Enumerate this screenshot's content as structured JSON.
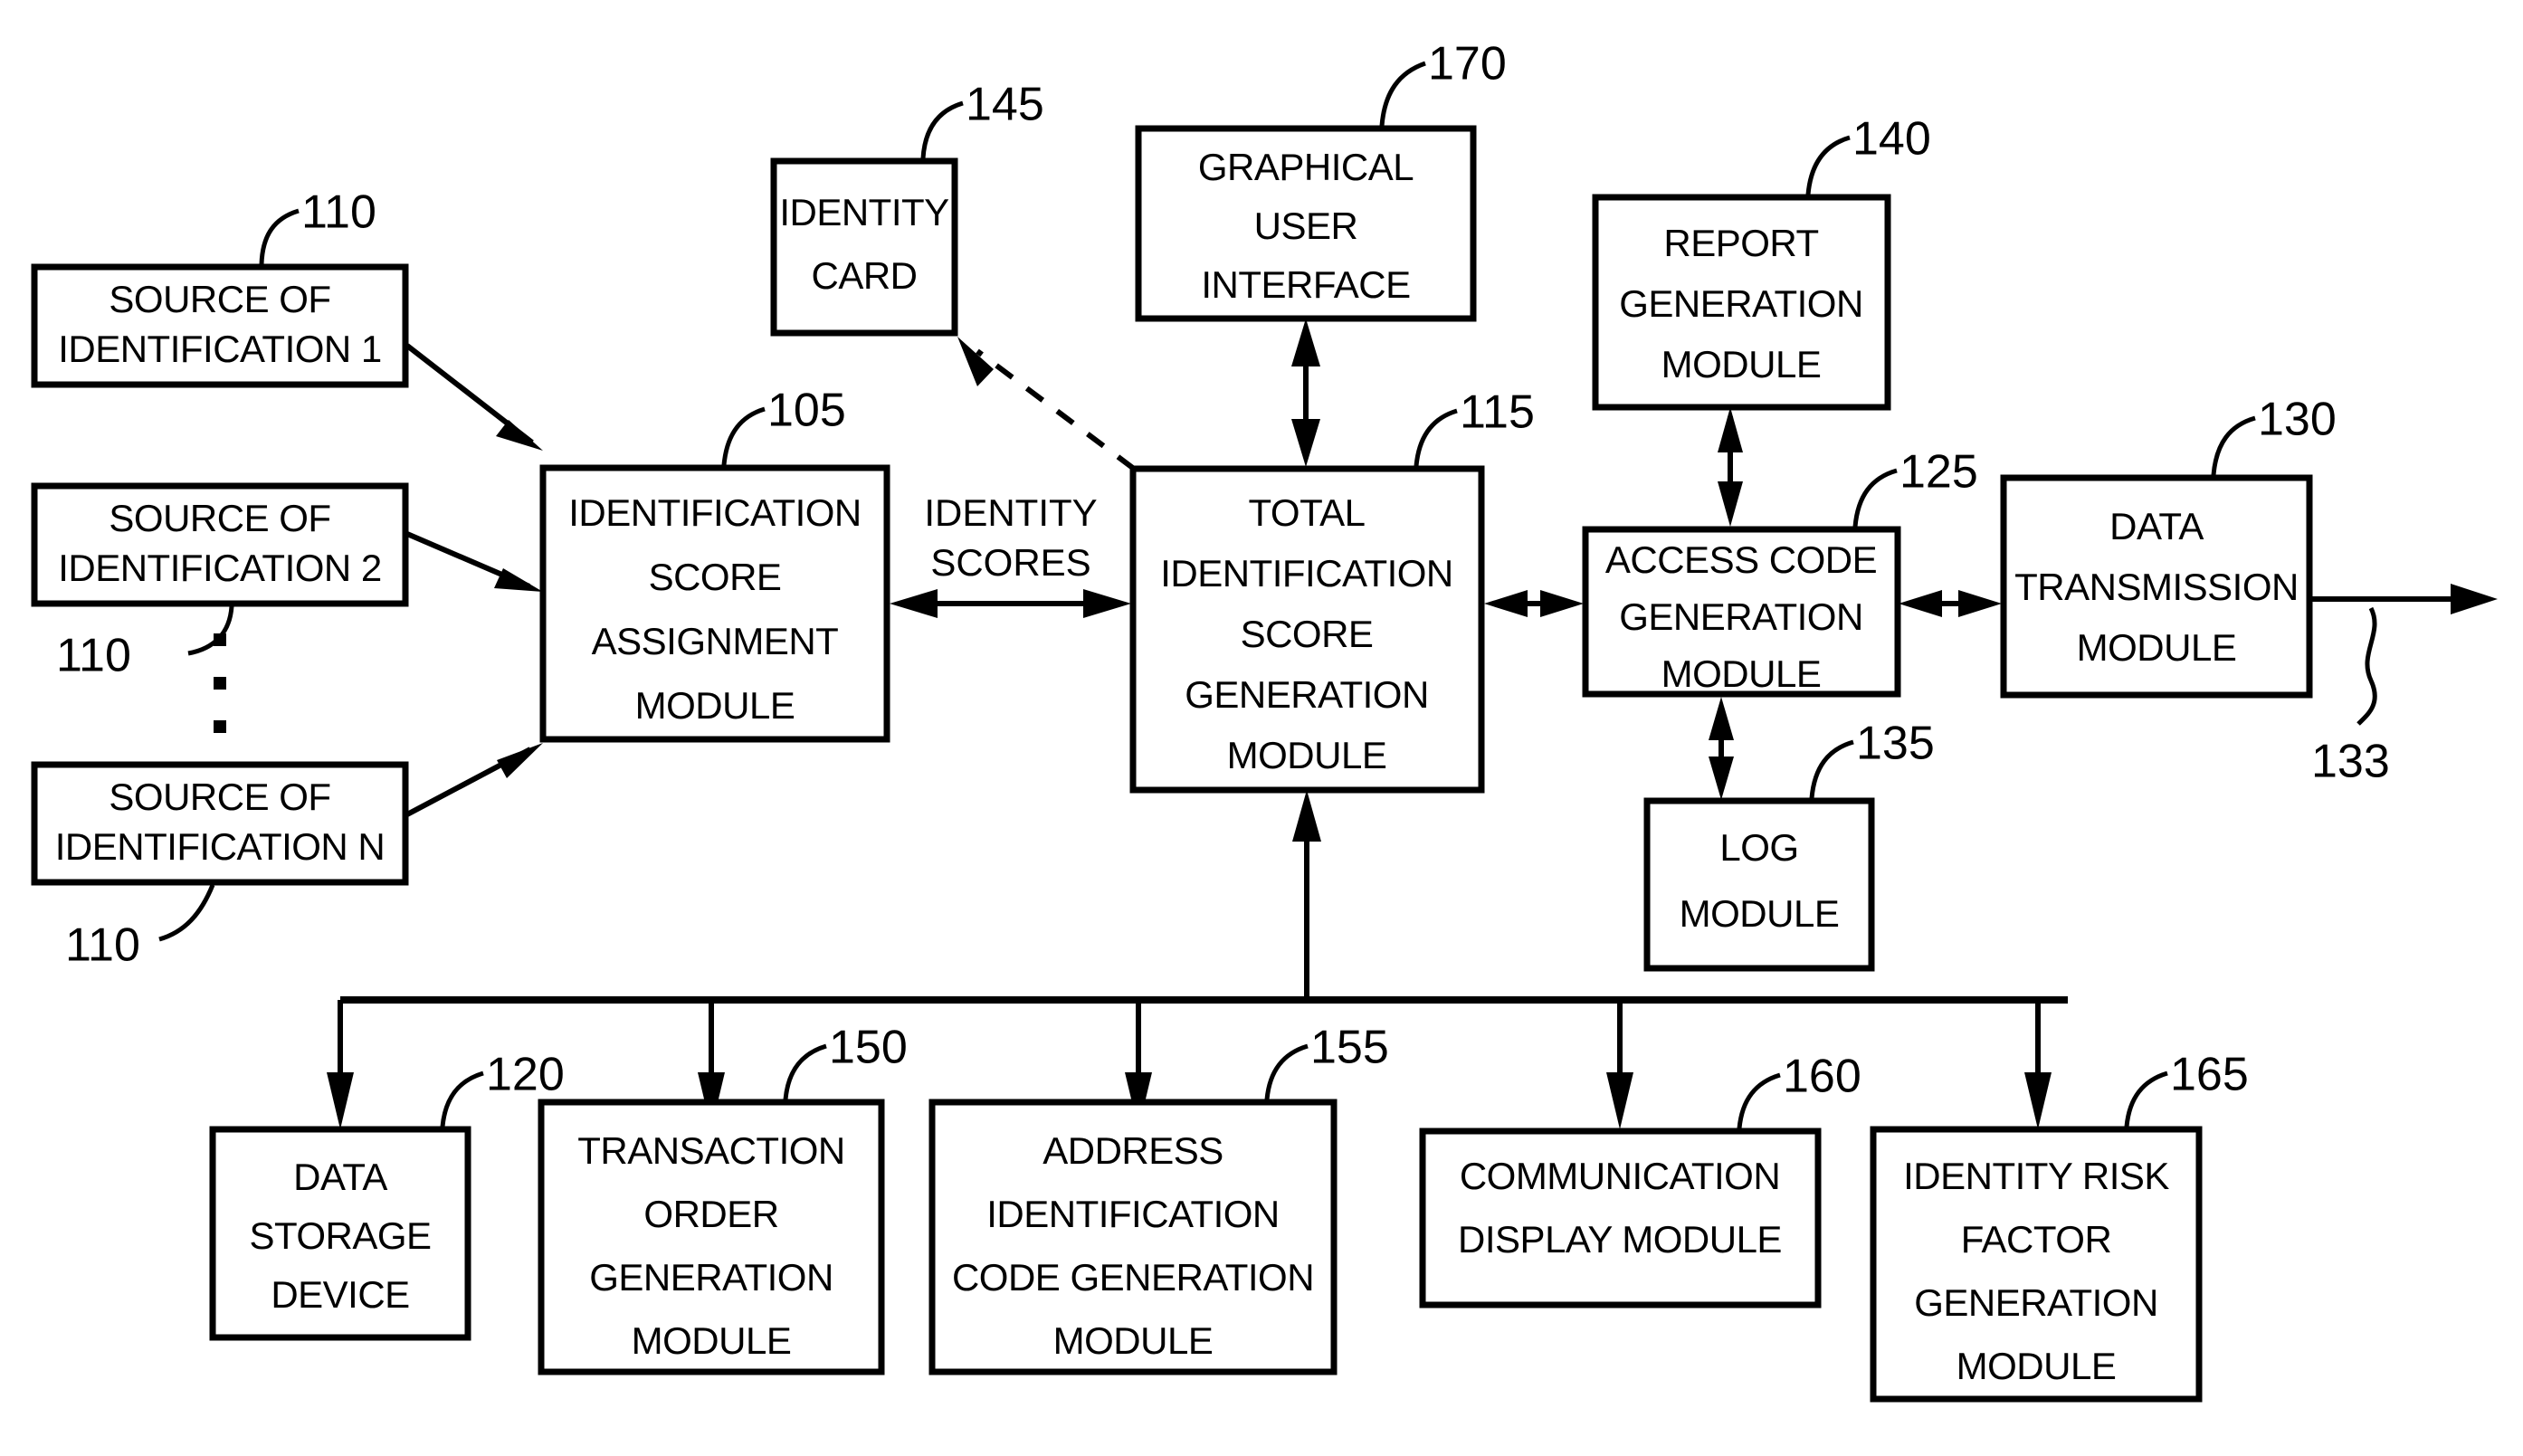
{
  "figure": {
    "type": "patent-block-diagram",
    "background_color": "#ffffff",
    "line_color": "#000000"
  },
  "blocks": {
    "source1": {
      "ref": "110",
      "lines": [
        "SOURCE OF",
        "IDENTIFICATION 1"
      ]
    },
    "source2": {
      "ref": "110",
      "lines": [
        "SOURCE OF",
        "IDENTIFICATION 2"
      ]
    },
    "sourceN": {
      "ref": "110",
      "lines": [
        "SOURCE OF",
        "IDENTIFICATION N"
      ]
    },
    "score_assignment": {
      "ref": "105",
      "lines": [
        "IDENTIFICATION",
        "SCORE",
        "ASSIGNMENT",
        "MODULE"
      ]
    },
    "identity_card": {
      "ref": "145",
      "lines": [
        "IDENTITY",
        "CARD"
      ]
    },
    "gui": {
      "ref": "170",
      "lines": [
        "GRAPHICAL",
        "USER",
        "INTERFACE"
      ]
    },
    "total_score": {
      "ref": "115",
      "lines": [
        "TOTAL",
        "IDENTIFICATION",
        "SCORE",
        "GENERATION",
        "MODULE"
      ]
    },
    "report_generation": {
      "ref": "140",
      "lines": [
        "REPORT",
        "GENERATION",
        "MODULE"
      ]
    },
    "access_code": {
      "ref": "125",
      "lines": [
        "ACCESS CODE",
        "GENERATION",
        "MODULE"
      ]
    },
    "data_transmission": {
      "ref": "130",
      "lines": [
        "DATA",
        "TRANSMISSION",
        "MODULE"
      ]
    },
    "log_module": {
      "ref": "135",
      "lines": [
        "LOG",
        "MODULE"
      ]
    },
    "data_storage": {
      "ref": "120",
      "lines": [
        "DATA",
        "STORAGE",
        "DEVICE"
      ]
    },
    "transaction_order": {
      "ref": "150",
      "lines": [
        "TRANSACTION",
        "ORDER",
        "GENERATION",
        "MODULE"
      ]
    },
    "address_code": {
      "ref": "155",
      "lines": [
        "ADDRESS",
        "IDENTIFICATION",
        "CODE GENERATION",
        "MODULE"
      ]
    },
    "communication_display": {
      "ref": "160",
      "lines": [
        "COMMUNICATION",
        "DISPLAY MODULE"
      ]
    },
    "identity_risk": {
      "ref": "165",
      "lines": [
        "IDENTITY RISK",
        "FACTOR",
        "GENERATION",
        "MODULE"
      ]
    }
  },
  "edge_labels": {
    "identity_scores": {
      "lines": [
        "IDENTITY",
        "SCORES"
      ]
    }
  },
  "standalone_refs": {
    "output_line": "133",
    "source2_ref": "110",
    "sourceN_ref": "110"
  }
}
